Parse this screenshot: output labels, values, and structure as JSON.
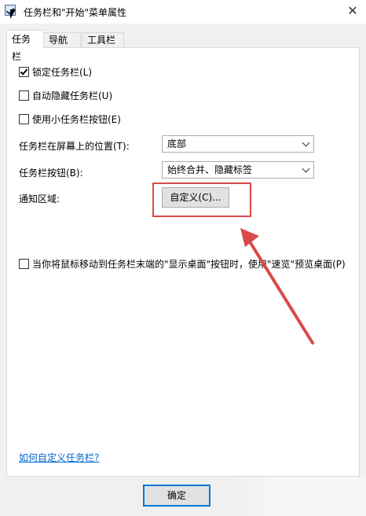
{
  "window": {
    "title": "任务栏和\"开始\"菜单属性",
    "close_glyph": "✕"
  },
  "tabs": [
    {
      "label": "任务栏",
      "active": true
    },
    {
      "label": "导航",
      "active": false
    },
    {
      "label": "工具栏",
      "active": false
    }
  ],
  "options": {
    "lock_taskbar": {
      "label": "锁定任务栏(L)",
      "checked": true
    },
    "auto_hide": {
      "label": "自动隐藏任务栏(U)",
      "checked": false
    },
    "small_buttons": {
      "label": "使用小任务栏按钮(E)",
      "checked": false
    }
  },
  "position": {
    "label": "任务栏在屏幕上的位置(T):",
    "value": "底部"
  },
  "buttons_combine": {
    "label": "任务栏按钮(B):",
    "value": "始终合并、隐藏标签"
  },
  "notification": {
    "label": "通知区域:",
    "customize_label": "自定义(C)..."
  },
  "peek": {
    "label": "当你将鼠标移动到任务栏末端的\"显示桌面\"按钮时，使用\"速览\"预览桌面(P)",
    "checked": false
  },
  "help_link": "如何自定义任务栏?",
  "footer": {
    "ok_label": "确定"
  },
  "colors": {
    "annotation": "#d94a4a",
    "link": "#0066cc",
    "focus": "#0078d7"
  }
}
